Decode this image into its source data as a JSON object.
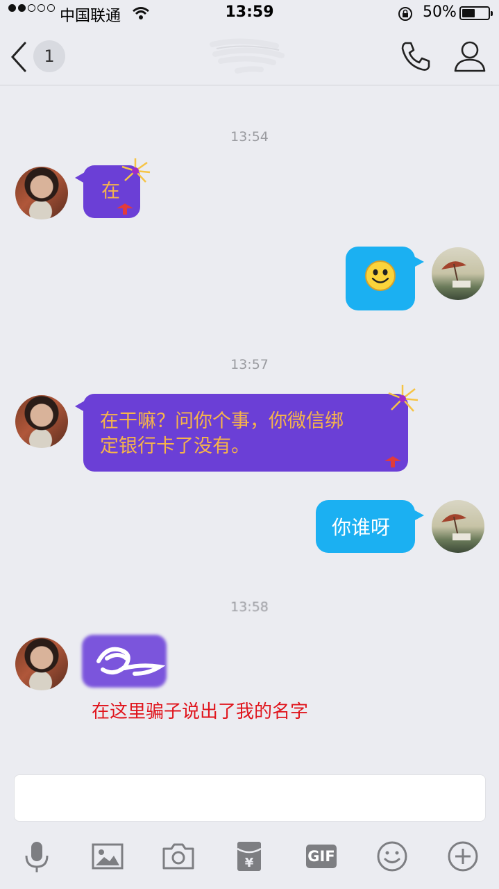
{
  "status_bar": {
    "carrier": "中国联通",
    "time": "13:59",
    "battery": "50%",
    "battery_level": 0.5
  },
  "nav": {
    "unread_count": "1"
  },
  "messages": [
    {
      "timestamp": "13:54"
    },
    {
      "from": "contact",
      "text": "在"
    },
    {
      "from": "me",
      "emoji": "smile"
    },
    {
      "timestamp": "13:57"
    },
    {
      "from": "contact",
      "text_line1": "在干嘛？问你个事，你微信绑",
      "text_line2": "定银行卡了没有。"
    },
    {
      "from": "me",
      "text": "你谁呀"
    },
    {
      "timestamp": "13:58"
    },
    {
      "from": "contact",
      "text": "[redacted]"
    }
  ],
  "annotation": "在这里骗子说出了我的名字",
  "toolbar": {
    "items": [
      "mic-icon",
      "image-icon",
      "camera-icon",
      "red-packet-icon",
      "gif-icon",
      "emoji-icon",
      "plus-icon"
    ],
    "gif_label": "GIF"
  },
  "colors": {
    "contact_bubble": "#6b3fd6",
    "contact_text": "#f6b44a",
    "my_bubble": "#1bb0f2",
    "annotation": "#e0141c"
  }
}
